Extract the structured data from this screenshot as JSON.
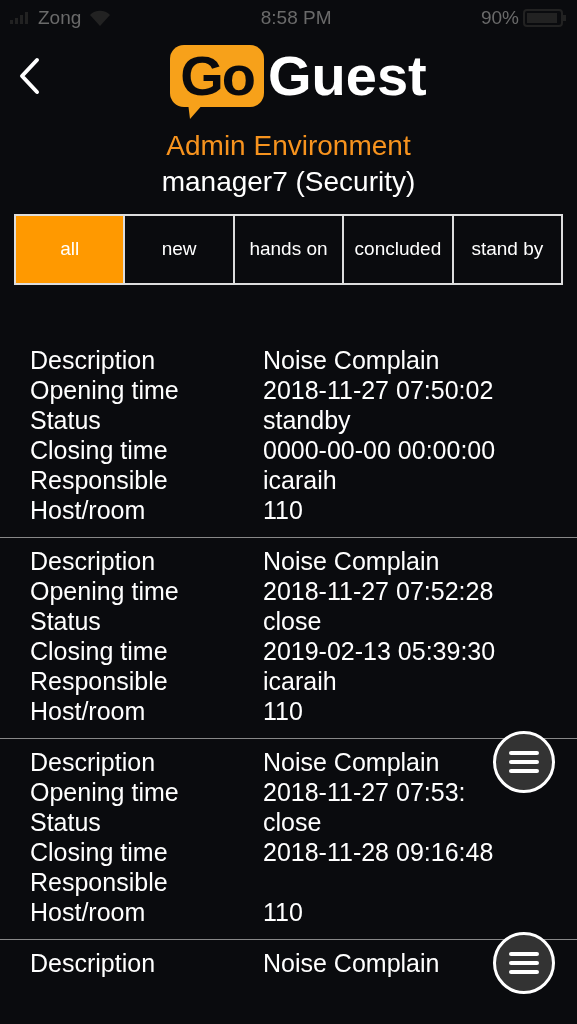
{
  "status_bar": {
    "carrier": "Zong",
    "time": "8:58 PM",
    "battery": "90%"
  },
  "header": {
    "logo_badge": "Go",
    "logo_word": "Guest"
  },
  "admin": {
    "title": "Admin Environment",
    "user": "manager7 (Security)"
  },
  "tabs": [
    {
      "label": "all",
      "selected": true
    },
    {
      "label": "new",
      "selected": false
    },
    {
      "label": "hands on",
      "selected": false
    },
    {
      "label": "concluded",
      "selected": false
    },
    {
      "label": "stand by",
      "selected": false
    }
  ],
  "records": [
    {
      "menu_button": false,
      "fields": [
        {
          "label": "Description",
          "value": "Noise Complain"
        },
        {
          "label": "Opening time",
          "value": "2018-11-27 07:50:02"
        },
        {
          "label": "Status",
          "value": "standby"
        },
        {
          "label": "Closing time",
          "value": "0000-00-00 00:00:00"
        },
        {
          "label": "Responsible",
          "value": "icaraih"
        },
        {
          "label": "Host/room",
          "value": "110"
        }
      ]
    },
    {
      "menu_button": false,
      "fields": [
        {
          "label": "Description",
          "value": "Noise Complain"
        },
        {
          "label": "Opening time",
          "value": "2018-11-27 07:52:28"
        },
        {
          "label": "Status",
          "value": "close"
        },
        {
          "label": "Closing time",
          "value": "2019-02-13 05:39:30"
        },
        {
          "label": "Responsible",
          "value": "icaraih"
        },
        {
          "label": "Host/room",
          "value": "110"
        }
      ]
    },
    {
      "menu_button": true,
      "fields": [
        {
          "label": "Description",
          "value": "Noise Complain"
        },
        {
          "label": "Opening time",
          "value": "2018-11-27 07:53:"
        },
        {
          "label": "Status",
          "value": "close"
        },
        {
          "label": "Closing time",
          "value": "2018-11-28 09:16:48"
        },
        {
          "label": "Responsible"
        },
        {
          "label": "Host/room",
          "value": "110"
        }
      ]
    },
    {
      "menu_button": true,
      "fields": [
        {
          "label": "Description",
          "value": "Noise Complain"
        }
      ]
    }
  ]
}
